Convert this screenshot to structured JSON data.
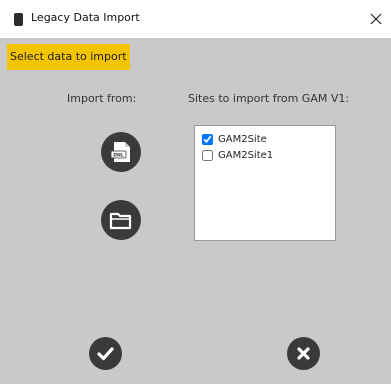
{
  "window": {
    "title": "Legacy Data Import"
  },
  "heading": "Select data to import",
  "import_from_label": "Import from:",
  "sites_label": "Sites to import from GAM V1:",
  "sites": [
    {
      "name": "GAM2Site",
      "checked": true
    },
    {
      "name": "GAM2Site1",
      "checked": false
    }
  ],
  "colors": {
    "heading_bg": "#f5c400",
    "button": "#3a3a3a",
    "panel_bg": "#c9c9c9"
  },
  "icons": [
    "app-icon",
    "close-icon",
    "dnl-file-icon",
    "folder-icon",
    "check-icon",
    "x-icon"
  ]
}
